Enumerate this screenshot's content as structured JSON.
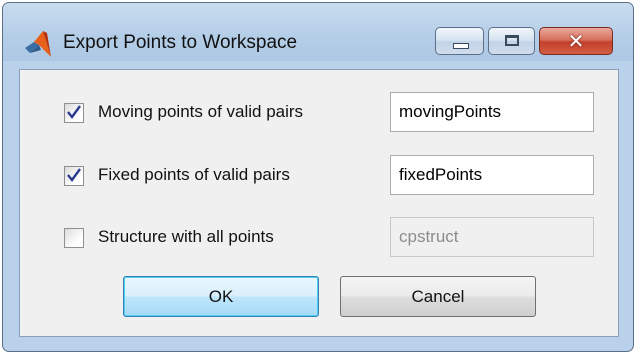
{
  "window": {
    "title": "Export Points to Workspace",
    "icon": "matlab-membrane-icon",
    "controls": [
      "minimize-icon",
      "maximize-icon",
      "close-icon"
    ]
  },
  "options": [
    {
      "label": "Moving points of valid pairs",
      "checked": true,
      "value": "movingPoints",
      "enabled": true
    },
    {
      "label": "Fixed points of valid pairs",
      "checked": true,
      "value": "fixedPoints",
      "enabled": true
    },
    {
      "label": "Structure with all points",
      "checked": false,
      "value": "cpstruct",
      "enabled": false
    }
  ],
  "buttons": {
    "ok": "OK",
    "cancel": "Cancel"
  },
  "colors": {
    "titlebar": "#b9d1ea",
    "close_button": "#c4402b",
    "default_button_border": "#3c7fb1"
  }
}
